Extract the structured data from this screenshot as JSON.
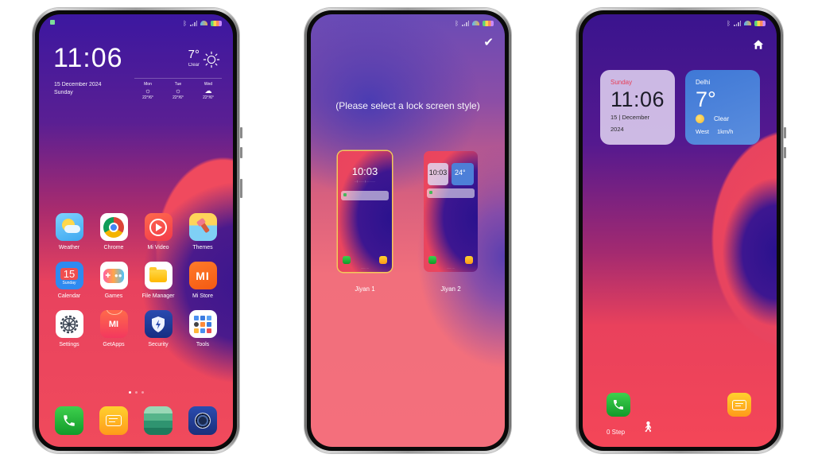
{
  "phones": [
    {
      "id": "home-screen",
      "status_bar": {
        "icons": [
          "notification-icon",
          "bluetooth-icon",
          "signal-icon",
          "wifi-icon",
          "battery-icon"
        ]
      },
      "clock_widget": {
        "time": "11:06",
        "date": "15 December 2024",
        "weekday": "Sunday",
        "temperature": "7°",
        "condition": "Clear",
        "weather_icon": "sun-icon",
        "forecast": [
          {
            "day": "Mon",
            "icon": "sun-icon",
            "range": "22°/6°"
          },
          {
            "day": "Tue",
            "icon": "sun-icon",
            "range": "22°/6°"
          },
          {
            "day": "Wed",
            "icon": "cloud-icon",
            "range": "22°/6°"
          }
        ]
      },
      "apps": [
        {
          "label": "Weather",
          "icon": "weather-app-icon"
        },
        {
          "label": "Chrome",
          "icon": "chrome-icon"
        },
        {
          "label": "Mi Video",
          "icon": "play-icon"
        },
        {
          "label": "Themes",
          "icon": "paintbrush-icon"
        },
        {
          "label": "Calendar",
          "icon": "calendar-icon",
          "badge": "15",
          "sublabel": "Sunday"
        },
        {
          "label": "Games",
          "icon": "gamepad-icon"
        },
        {
          "label": "File Manager",
          "icon": "folder-icon"
        },
        {
          "label": "Mi Store",
          "icon": "mi-logo-icon",
          "glyph": "mi"
        },
        {
          "label": "Settings",
          "icon": "gear-icon"
        },
        {
          "label": "GetApps",
          "icon": "getapps-icon",
          "glyph": "mi"
        },
        {
          "label": "Security",
          "icon": "shield-icon"
        },
        {
          "label": "Tools",
          "icon": "tools-grid-icon"
        }
      ],
      "page_indicator": {
        "pages": 3,
        "current": 1
      },
      "dock": [
        {
          "name": "phone",
          "icon": "phone-icon"
        },
        {
          "name": "messages",
          "icon": "message-icon"
        },
        {
          "name": "gallery",
          "icon": "gallery-icon"
        },
        {
          "name": "camera",
          "icon": "camera-icon"
        }
      ]
    },
    {
      "id": "lock-style-picker",
      "confirm_icon": "checkmark-icon",
      "prompt": "(Please select a lock screen style)",
      "styles": [
        {
          "label": "Jiyan 1",
          "selected": true,
          "preview_time": "10:03"
        },
        {
          "label": "Jiyan 2",
          "selected": false,
          "preview_time": "10:03",
          "preview_temp": "24°"
        }
      ]
    },
    {
      "id": "lock-screen",
      "home_icon": "home-icon",
      "clock_widget": {
        "weekday": "Sunday",
        "time": "11:06",
        "date": "15 | December",
        "year": "2024"
      },
      "weather_widget": {
        "city": "Delhi",
        "temperature": "7°",
        "condition": "Clear",
        "wind_direction": "West",
        "wind_speed": "1km/h"
      },
      "shortcuts": [
        {
          "name": "phone",
          "icon": "phone-icon"
        },
        {
          "name": "messages",
          "icon": "message-icon"
        }
      ],
      "steps": "0 Step"
    }
  ],
  "colors": {
    "accent_red": "#f04a5c",
    "deep_purple": "#3c17a0",
    "selection_outline": "#f3c85a",
    "weekday_red": "#e83e56"
  }
}
